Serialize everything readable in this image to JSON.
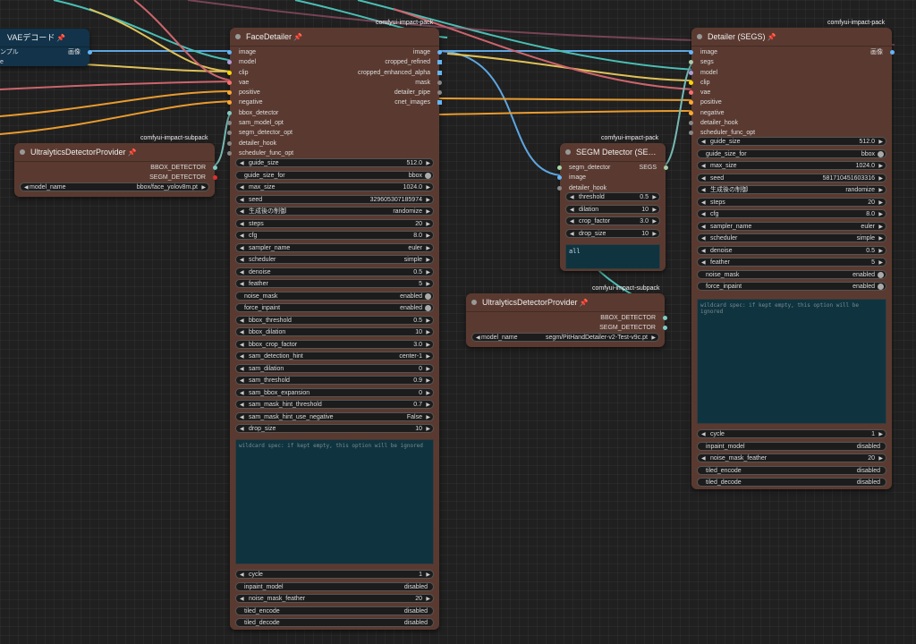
{
  "colors": {
    "image": "#64b5f6",
    "model": "#b39ddb",
    "clip": "#ffd500",
    "vae": "#ff6e6e",
    "cond": "#ffa931",
    "bbox": "#80cbc4",
    "segm": "#a5d6a7",
    "segs": "#aaccaa"
  },
  "vae_node": {
    "title": "VAEデコード",
    "input_partial": "ンプル",
    "input2_partial": "e",
    "output": "画像"
  },
  "ultra1": {
    "title": "UltralyticsDetectorProvider",
    "pack": "comfyui-impact-subpack",
    "outputs": [
      "BBOX_DETECTOR",
      "SEGM_DETECTOR"
    ],
    "model_label": "model_name",
    "model_value": "bbox/face_yolov8m.pt"
  },
  "ultra2": {
    "title": "UltralyticsDetectorProvider",
    "pack": "comfyui-impact-subpack",
    "outputs": [
      "BBOX_DETECTOR",
      "SEGM_DETECTOR"
    ],
    "model_label": "model_name",
    "model_value": "segm/PitHandDetailer-v2-Test-v9c.pt"
  },
  "face": {
    "title": "FaceDetailer",
    "pack": "comfyui-impact-pack",
    "inputs": [
      "image",
      "model",
      "clip",
      "vae",
      "positive",
      "negative",
      "bbox_detector",
      "sam_model_opt",
      "segm_detector_opt",
      "detailer_hook",
      "scheduler_func_opt"
    ],
    "outputs": [
      "image",
      "cropped_refined",
      "cropped_enhanced_alpha",
      "mask",
      "detailer_pipe",
      "cnet_images"
    ],
    "widgets": [
      {
        "label": "guide_size",
        "value": "512.0",
        "kind": "num"
      },
      {
        "label": "guide_size_for",
        "value": "bbox",
        "kind": "toggle"
      },
      {
        "label": "max_size",
        "value": "1024.0",
        "kind": "num"
      },
      {
        "label": "seed",
        "value": "329605307185974",
        "kind": "num"
      },
      {
        "label": "生成後の制御",
        "value": "randomize",
        "kind": "num"
      },
      {
        "label": "steps",
        "value": "20",
        "kind": "num"
      },
      {
        "label": "cfg",
        "value": "8.0",
        "kind": "num"
      },
      {
        "label": "sampler_name",
        "value": "euler",
        "kind": "num"
      },
      {
        "label": "scheduler",
        "value": "simple",
        "kind": "num"
      },
      {
        "label": "denoise",
        "value": "0.5",
        "kind": "num"
      },
      {
        "label": "feather",
        "value": "5",
        "kind": "num"
      },
      {
        "label": "noise_mask",
        "value": "enabled",
        "kind": "toggle"
      },
      {
        "label": "force_inpaint",
        "value": "enabled",
        "kind": "toggle"
      },
      {
        "label": "bbox_threshold",
        "value": "0.5",
        "kind": "num"
      },
      {
        "label": "bbox_dilation",
        "value": "10",
        "kind": "num"
      },
      {
        "label": "bbox_crop_factor",
        "value": "3.0",
        "kind": "num"
      },
      {
        "label": "sam_detection_hint",
        "value": "center-1",
        "kind": "num"
      },
      {
        "label": "sam_dilation",
        "value": "0",
        "kind": "num"
      },
      {
        "label": "sam_threshold",
        "value": "0.9",
        "kind": "num"
      },
      {
        "label": "sam_bbox_expansion",
        "value": "0",
        "kind": "num"
      },
      {
        "label": "sam_mask_hint_threshold",
        "value": "0.7",
        "kind": "num"
      },
      {
        "label": "sam_mask_hint_use_negative",
        "value": "False",
        "kind": "num"
      },
      {
        "label": "drop_size",
        "value": "10",
        "kind": "num"
      }
    ],
    "wildcard_placeholder": "wildcard spec: if kept empty, this option will be ignored",
    "widgets2": [
      {
        "label": "cycle",
        "value": "1",
        "kind": "num"
      },
      {
        "label": "inpaint_model",
        "value": "disabled",
        "kind": "plain"
      },
      {
        "label": "noise_mask_feather",
        "value": "20",
        "kind": "num"
      },
      {
        "label": "tiled_encode",
        "value": "disabled",
        "kind": "plain"
      },
      {
        "label": "tiled_decode",
        "value": "disabled",
        "kind": "plain"
      }
    ]
  },
  "segm": {
    "title": "SEGM Detector (SE…",
    "pack": "comfyui-impact-pack",
    "inputs": [
      "segm_detector",
      "image",
      "detailer_hook"
    ],
    "outputs": [
      "SEGS"
    ],
    "widgets": [
      {
        "label": "threshold",
        "value": "0.5",
        "kind": "num"
      },
      {
        "label": "dilation",
        "value": "10",
        "kind": "num"
      },
      {
        "label": "crop_factor",
        "value": "3.0",
        "kind": "num"
      },
      {
        "label": "drop_size",
        "value": "10",
        "kind": "num"
      }
    ],
    "text": "all"
  },
  "detailer": {
    "title": "Detailer (SEGS)",
    "pack": "comfyui-impact-pack",
    "inputs": [
      "image",
      "segs",
      "model",
      "clip",
      "vae",
      "positive",
      "negative",
      "detailer_hook",
      "scheduler_func_opt"
    ],
    "outputs": [
      "画像"
    ],
    "widgets": [
      {
        "label": "guide_size",
        "value": "512.0",
        "kind": "num"
      },
      {
        "label": "guide_size_for",
        "value": "bbox",
        "kind": "toggle"
      },
      {
        "label": "max_size",
        "value": "1024.0",
        "kind": "num"
      },
      {
        "label": "seed",
        "value": "581710451603316",
        "kind": "num"
      },
      {
        "label": "生成後の制御",
        "value": "randomize",
        "kind": "num"
      },
      {
        "label": "steps",
        "value": "20",
        "kind": "num"
      },
      {
        "label": "cfg",
        "value": "8.0",
        "kind": "num"
      },
      {
        "label": "sampler_name",
        "value": "euler",
        "kind": "num"
      },
      {
        "label": "scheduler",
        "value": "simple",
        "kind": "num"
      },
      {
        "label": "denoise",
        "value": "0.5",
        "kind": "num"
      },
      {
        "label": "feather",
        "value": "5",
        "kind": "num"
      },
      {
        "label": "noise_mask",
        "value": "enabled",
        "kind": "toggle"
      },
      {
        "label": "force_inpaint",
        "value": "enabled",
        "kind": "toggle"
      }
    ],
    "wildcard_placeholder": "wildcard spec: if kept empty, this option will be ignored",
    "widgets2": [
      {
        "label": "cycle",
        "value": "1",
        "kind": "num"
      },
      {
        "label": "inpaint_model",
        "value": "disabled",
        "kind": "plain"
      },
      {
        "label": "noise_mask_feather",
        "value": "20",
        "kind": "num"
      },
      {
        "label": "tiled_encode",
        "value": "disabled",
        "kind": "plain"
      },
      {
        "label": "tiled_decode",
        "value": "disabled",
        "kind": "plain"
      }
    ]
  }
}
